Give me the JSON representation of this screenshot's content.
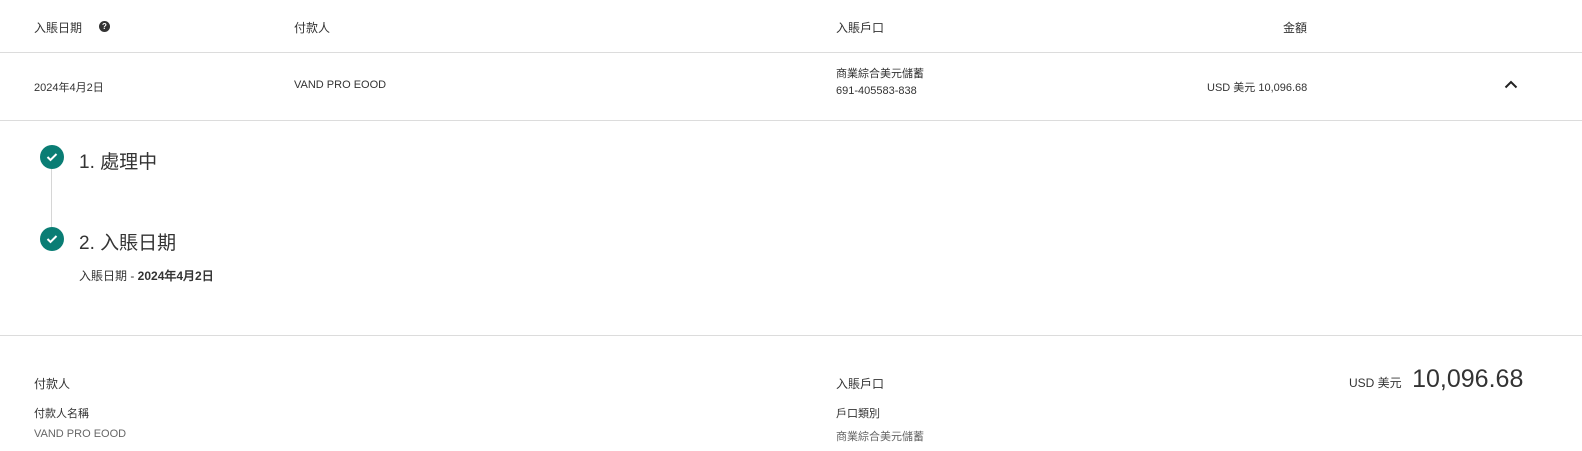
{
  "table": {
    "headers": {
      "date": "入賬日期",
      "payer": "付款人",
      "account": "入賬戶口",
      "amount": "金額"
    },
    "row": {
      "date": "2024年4月2日",
      "payer": "VAND PRO EOOD",
      "account_name": "商業綜合美元儲蓄",
      "account_number": "691-405583-838",
      "amount": "USD 美元 10,096.68"
    }
  },
  "steps": [
    {
      "title": "1. 處理中"
    },
    {
      "title": "2. 入賬日期",
      "detail_label": "入賬日期 - ",
      "detail_value": "2024年4月2日"
    }
  ],
  "details": {
    "payer_section": "付款人",
    "payer_name_label": "付款人名稱",
    "payer_name": "VAND PRO EOOD",
    "account_section": "入賬戶口",
    "account_type_label": "戶口類別",
    "account_type": "商業綜合美元儲蓄",
    "amount_currency": "USD 美元",
    "amount_value": "10,096.68"
  },
  "colors": {
    "accent": "#0a7d74",
    "divider": "#dcdcdc"
  },
  "icons": {
    "help": "question-circle-icon",
    "collapse": "chevron-up-icon",
    "step": "check-circle-icon"
  }
}
